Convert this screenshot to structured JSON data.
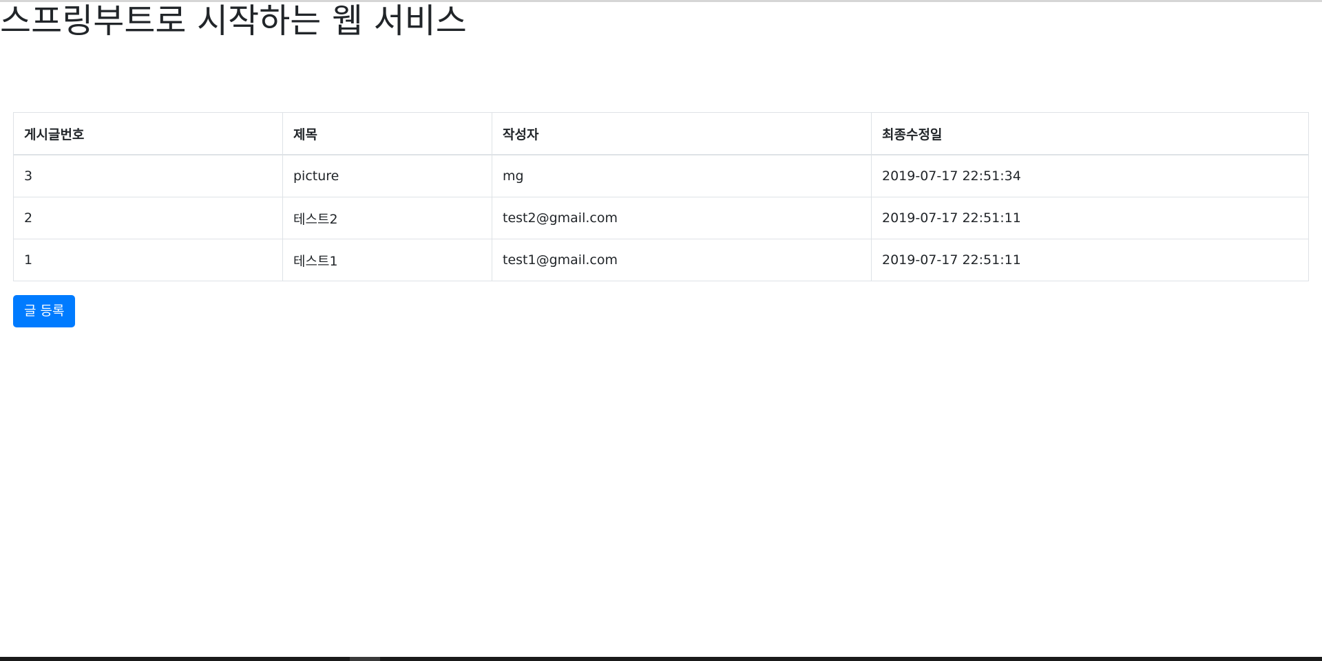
{
  "header": {
    "title": "스프링부트로 시작하는 웹 서비스"
  },
  "table": {
    "columns": [
      "게시글번호",
      "제목",
      "작성자",
      "최종수정일"
    ],
    "rows": [
      {
        "id": "3",
        "title": "picture",
        "author": "mg",
        "modified": "2019-07-17 22:51:34"
      },
      {
        "id": "2",
        "title": "테스트2",
        "author": "test2@gmail.com",
        "modified": "2019-07-17 22:51:11"
      },
      {
        "id": "1",
        "title": "테스트1",
        "author": "test1@gmail.com",
        "modified": "2019-07-17 22:51:11"
      }
    ]
  },
  "actions": {
    "write_label": "글 등록"
  },
  "colors": {
    "primary": "#007bff",
    "border": "#dee2e6",
    "text": "#212529"
  }
}
